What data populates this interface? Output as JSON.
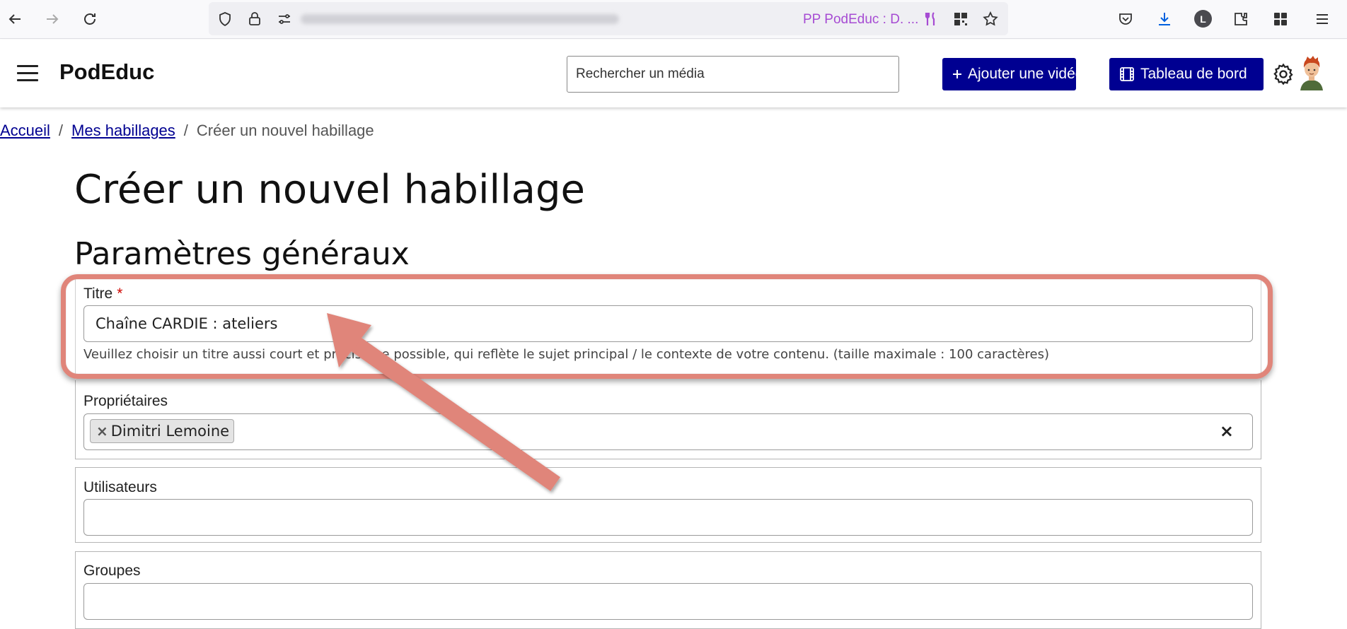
{
  "browser": {
    "tab_title": "PP PodEduc : D. ...",
    "account_initial": "L",
    "icons": [
      "back-arrow-icon",
      "forward-arrow-icon",
      "reload-icon",
      "shield-icon",
      "lock-icon",
      "permissions-icon",
      "fork-knife-icon",
      "qr-code-icon",
      "star-icon",
      "pocket-icon",
      "download-icon",
      "extensions-icon",
      "apps-icon",
      "menu-icon"
    ]
  },
  "header": {
    "brand": "PodEduc",
    "search_placeholder": "Rechercher un média",
    "add_video_label": "Ajouter une vidéo",
    "dashboard_label": "Tableau de bord",
    "accent_color": "#000091"
  },
  "breadcrumb": {
    "items": [
      {
        "label": "Accueil"
      },
      {
        "label": "Mes habillages"
      },
      {
        "label": "Créer un nouvel habillage"
      }
    ],
    "separator": "/"
  },
  "page": {
    "title": "Créer un nouvel habillage",
    "section_title": "Paramètres généraux"
  },
  "form": {
    "title_field": {
      "label": "Titre",
      "required_mark": "*",
      "value": "Chaîne CARDIE : ateliers",
      "help": "Veuillez choisir un titre aussi court et précis que possible, qui reflète le sujet principal / le contexte de votre contenu. (taille maximale : 100 caractères)"
    },
    "owners_field": {
      "label": "Propriétaires",
      "tags": [
        "Dimitri Lemoine"
      ],
      "tag_remove": "×",
      "clear": "×"
    },
    "users_field": {
      "label": "Utilisateurs",
      "value": ""
    },
    "groups_field": {
      "label": "Groupes",
      "value": ""
    }
  },
  "annotation": {
    "color": "#e0857a"
  }
}
